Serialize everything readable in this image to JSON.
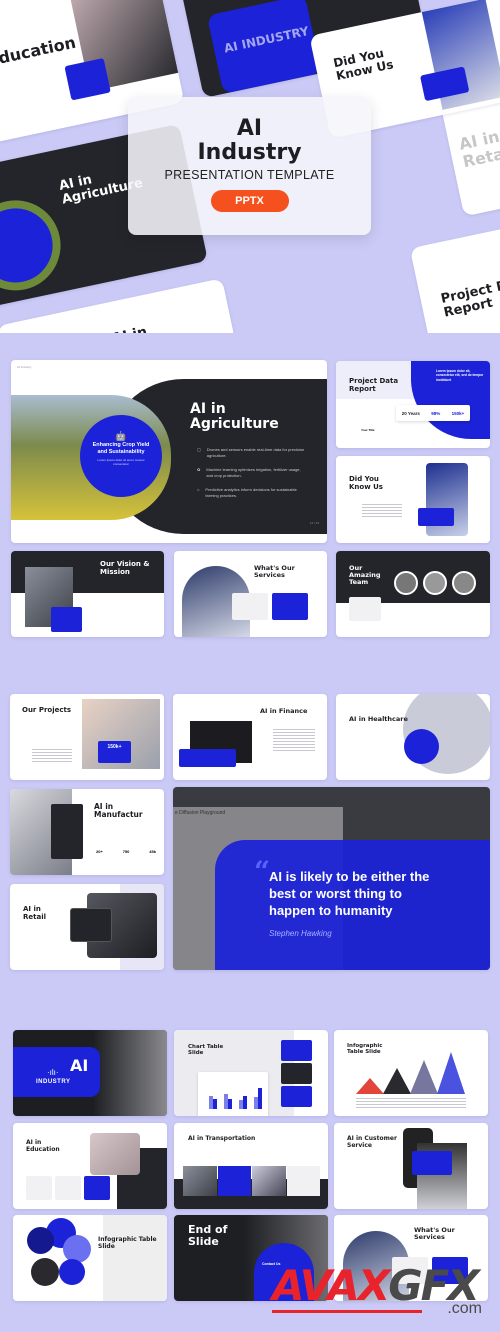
{
  "hero": {
    "title_line1": "AI",
    "title_line2": "Industry",
    "subtitle": "PRESENTATION TEMPLATE",
    "badge": "PPTX",
    "bg_cards": [
      "AI in Education",
      "Did You Know Us",
      "AI in Agriculture",
      "AI in Finance",
      "Project Data Report",
      "AI in Retail",
      "AI INDUSTRY"
    ]
  },
  "colors": {
    "background": "#cbcaf6",
    "accent_blue": "#1b22d8",
    "dark": "#24252a",
    "badge_orange": "#f4511e"
  },
  "brand": "AI Industry",
  "agriculture": {
    "title": "AI in Agriculture",
    "circle_title": "Enhancing Crop Yield and Sustainability",
    "circle_text": "Lorem ipsum dolor sit amet, tempor consectetur",
    "bullets": [
      "Drones and sensors enable real-time data for precision agriculture.",
      "Machine learning optimizes irrigation, fertilizer usage, and crop protection.",
      "Predictive analytics inform decisions for sustainable farming practices."
    ],
    "page": "14 / 23"
  },
  "data_report": {
    "title": "Project Data Report",
    "quote": "Lorem ipsum dolor sit, consectetur elit, sed do tempor incididunt",
    "stats": [
      "20 Years",
      "98%",
      "150k+"
    ],
    "item": "Your Title"
  },
  "slides": {
    "did_you_know": "Did You Know Us",
    "vision": "Our Vision & Mission",
    "services": "What's Our Services",
    "team": "Our Amazing Team",
    "projects": "Our Projects",
    "projects_stat": "150k+",
    "finance": "AI in Finance",
    "healthcare": "AI in Healthcare",
    "manufacturing": "AI in Manufactur",
    "manufacturing_stats": [
      "20+",
      "750",
      "45k"
    ],
    "retail": "AI in Retail",
    "cover_title": "AI",
    "cover_sub": "INDUSTRY",
    "chart": "Chart Table Slide",
    "infographic": "Infographic Table Slide",
    "education": "AI in Education",
    "transportation": "AI in Transportation",
    "customer": "AI in Customer Service",
    "infographic2": "Infographic Table Slide",
    "end": "End of Slide",
    "contact": "Contact Us",
    "services2": "What's Our Services"
  },
  "quote": {
    "text": "AI is likely to be either the best or worst thing to happen to humanity",
    "author": "Stephen Hawking",
    "screen_text": "e Diffusion Playground"
  },
  "watermark": {
    "main": "AVAXGFX",
    "sub": ".com"
  }
}
